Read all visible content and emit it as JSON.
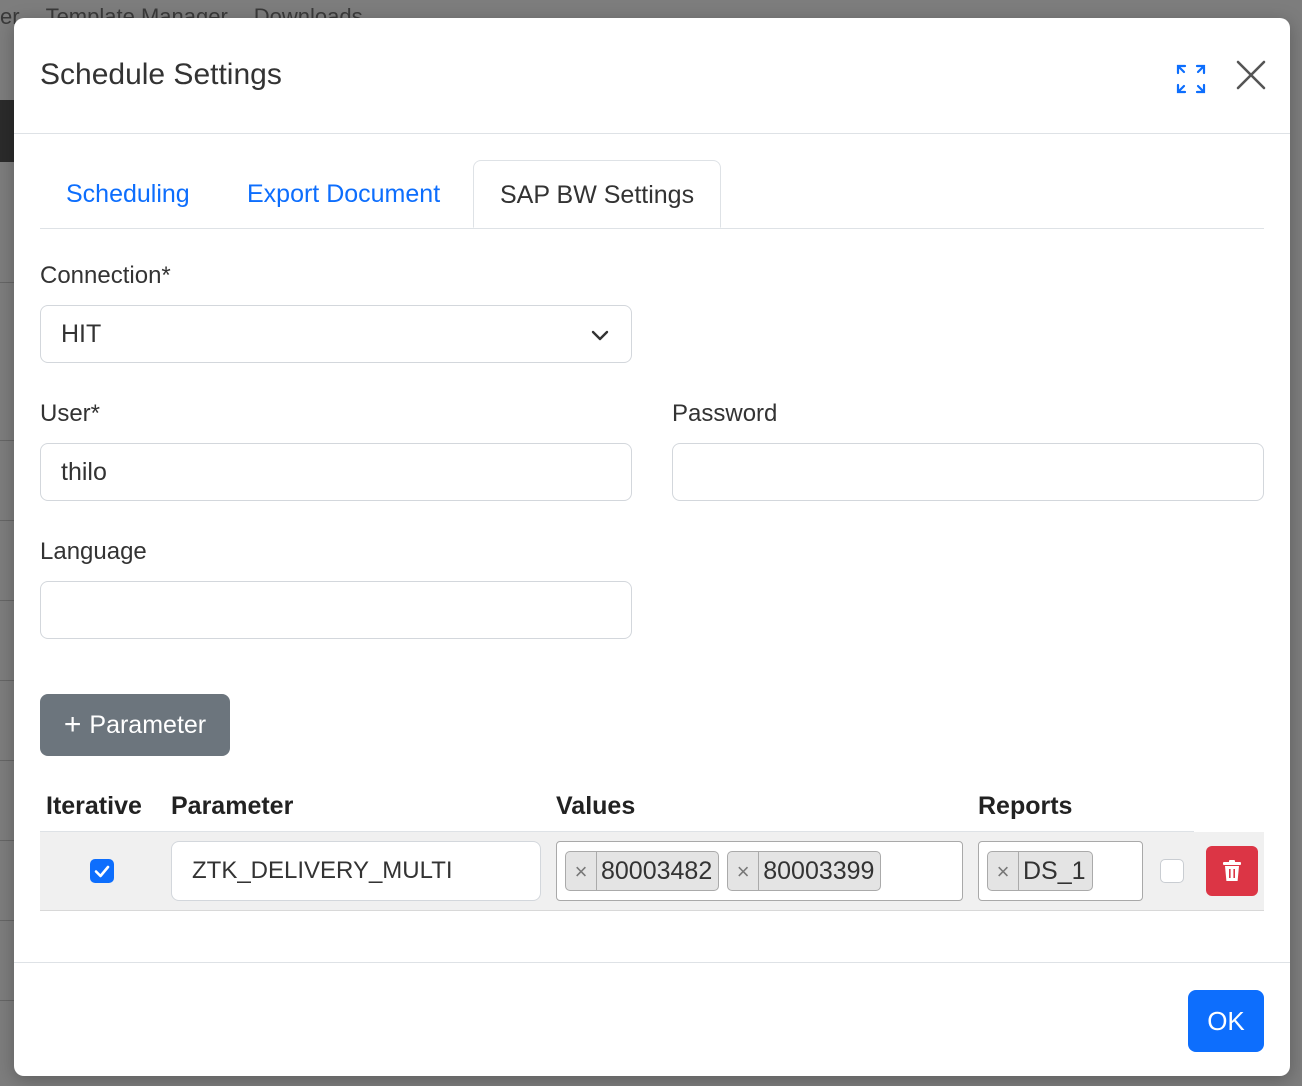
{
  "background": {
    "nav_items": [
      "er",
      "Template Manager",
      "Downloads"
    ]
  },
  "modal": {
    "title": "Schedule Settings",
    "tabs": [
      {
        "label": "Scheduling",
        "active": false
      },
      {
        "label": "Export Document",
        "active": false
      },
      {
        "label": "SAP BW Settings",
        "active": true
      }
    ],
    "connection": {
      "label": "Connection*",
      "value": "HIT"
    },
    "user": {
      "label": "User*",
      "value": "thilo"
    },
    "password": {
      "label": "Password",
      "value": ""
    },
    "language": {
      "label": "Language",
      "value": ""
    },
    "add_parameter_label": "Parameter",
    "table": {
      "headers": {
        "iterative": "Iterative",
        "parameter": "Parameter",
        "values": "Values",
        "reports": "Reports"
      },
      "rows": [
        {
          "iterative": true,
          "parameter": "ZTK_DELIVERY_MULTI",
          "values": [
            "80003482",
            "80003399"
          ],
          "reports": [
            "DS_1"
          ],
          "extra_checked": false
        }
      ]
    },
    "ok_label": "OK"
  },
  "colors": {
    "primary": "#0d6efd",
    "secondary": "#6c757d",
    "danger": "#dc3545"
  }
}
